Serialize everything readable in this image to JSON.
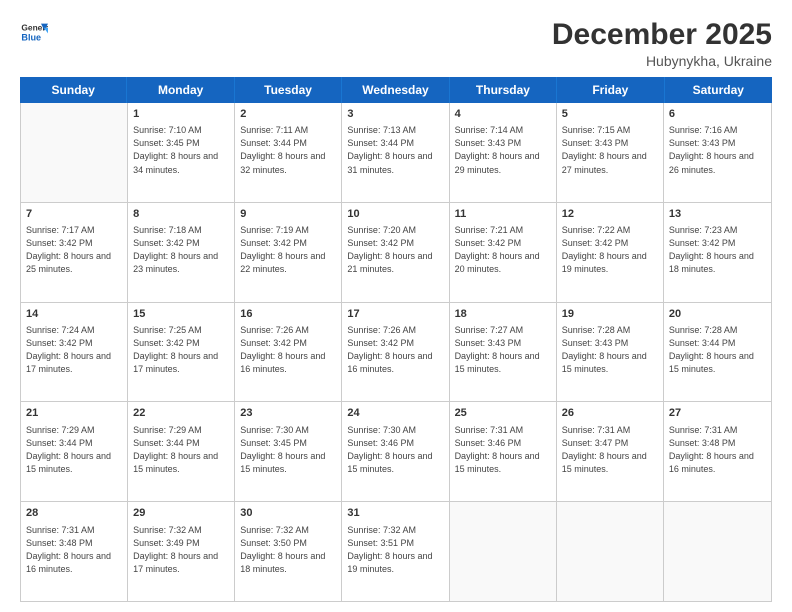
{
  "logo": {
    "general": "General",
    "blue": "Blue"
  },
  "header": {
    "month": "December 2025",
    "location": "Hubynykha, Ukraine"
  },
  "weekdays": [
    "Sunday",
    "Monday",
    "Tuesday",
    "Wednesday",
    "Thursday",
    "Friday",
    "Saturday"
  ],
  "rows": [
    [
      {
        "day": "",
        "empty": true
      },
      {
        "day": "1",
        "sunrise": "Sunrise: 7:10 AM",
        "sunset": "Sunset: 3:45 PM",
        "daylight": "Daylight: 8 hours and 34 minutes."
      },
      {
        "day": "2",
        "sunrise": "Sunrise: 7:11 AM",
        "sunset": "Sunset: 3:44 PM",
        "daylight": "Daylight: 8 hours and 32 minutes."
      },
      {
        "day": "3",
        "sunrise": "Sunrise: 7:13 AM",
        "sunset": "Sunset: 3:44 PM",
        "daylight": "Daylight: 8 hours and 31 minutes."
      },
      {
        "day": "4",
        "sunrise": "Sunrise: 7:14 AM",
        "sunset": "Sunset: 3:43 PM",
        "daylight": "Daylight: 8 hours and 29 minutes."
      },
      {
        "day": "5",
        "sunrise": "Sunrise: 7:15 AM",
        "sunset": "Sunset: 3:43 PM",
        "daylight": "Daylight: 8 hours and 27 minutes."
      },
      {
        "day": "6",
        "sunrise": "Sunrise: 7:16 AM",
        "sunset": "Sunset: 3:43 PM",
        "daylight": "Daylight: 8 hours and 26 minutes."
      }
    ],
    [
      {
        "day": "7",
        "sunrise": "Sunrise: 7:17 AM",
        "sunset": "Sunset: 3:42 PM",
        "daylight": "Daylight: 8 hours and 25 minutes."
      },
      {
        "day": "8",
        "sunrise": "Sunrise: 7:18 AM",
        "sunset": "Sunset: 3:42 PM",
        "daylight": "Daylight: 8 hours and 23 minutes."
      },
      {
        "day": "9",
        "sunrise": "Sunrise: 7:19 AM",
        "sunset": "Sunset: 3:42 PM",
        "daylight": "Daylight: 8 hours and 22 minutes."
      },
      {
        "day": "10",
        "sunrise": "Sunrise: 7:20 AM",
        "sunset": "Sunset: 3:42 PM",
        "daylight": "Daylight: 8 hours and 21 minutes."
      },
      {
        "day": "11",
        "sunrise": "Sunrise: 7:21 AM",
        "sunset": "Sunset: 3:42 PM",
        "daylight": "Daylight: 8 hours and 20 minutes."
      },
      {
        "day": "12",
        "sunrise": "Sunrise: 7:22 AM",
        "sunset": "Sunset: 3:42 PM",
        "daylight": "Daylight: 8 hours and 19 minutes."
      },
      {
        "day": "13",
        "sunrise": "Sunrise: 7:23 AM",
        "sunset": "Sunset: 3:42 PM",
        "daylight": "Daylight: 8 hours and 18 minutes."
      }
    ],
    [
      {
        "day": "14",
        "sunrise": "Sunrise: 7:24 AM",
        "sunset": "Sunset: 3:42 PM",
        "daylight": "Daylight: 8 hours and 17 minutes."
      },
      {
        "day": "15",
        "sunrise": "Sunrise: 7:25 AM",
        "sunset": "Sunset: 3:42 PM",
        "daylight": "Daylight: 8 hours and 17 minutes."
      },
      {
        "day": "16",
        "sunrise": "Sunrise: 7:26 AM",
        "sunset": "Sunset: 3:42 PM",
        "daylight": "Daylight: 8 hours and 16 minutes."
      },
      {
        "day": "17",
        "sunrise": "Sunrise: 7:26 AM",
        "sunset": "Sunset: 3:42 PM",
        "daylight": "Daylight: 8 hours and 16 minutes."
      },
      {
        "day": "18",
        "sunrise": "Sunrise: 7:27 AM",
        "sunset": "Sunset: 3:43 PM",
        "daylight": "Daylight: 8 hours and 15 minutes."
      },
      {
        "day": "19",
        "sunrise": "Sunrise: 7:28 AM",
        "sunset": "Sunset: 3:43 PM",
        "daylight": "Daylight: 8 hours and 15 minutes."
      },
      {
        "day": "20",
        "sunrise": "Sunrise: 7:28 AM",
        "sunset": "Sunset: 3:44 PM",
        "daylight": "Daylight: 8 hours and 15 minutes."
      }
    ],
    [
      {
        "day": "21",
        "sunrise": "Sunrise: 7:29 AM",
        "sunset": "Sunset: 3:44 PM",
        "daylight": "Daylight: 8 hours and 15 minutes."
      },
      {
        "day": "22",
        "sunrise": "Sunrise: 7:29 AM",
        "sunset": "Sunset: 3:44 PM",
        "daylight": "Daylight: 8 hours and 15 minutes."
      },
      {
        "day": "23",
        "sunrise": "Sunrise: 7:30 AM",
        "sunset": "Sunset: 3:45 PM",
        "daylight": "Daylight: 8 hours and 15 minutes."
      },
      {
        "day": "24",
        "sunrise": "Sunrise: 7:30 AM",
        "sunset": "Sunset: 3:46 PM",
        "daylight": "Daylight: 8 hours and 15 minutes."
      },
      {
        "day": "25",
        "sunrise": "Sunrise: 7:31 AM",
        "sunset": "Sunset: 3:46 PM",
        "daylight": "Daylight: 8 hours and 15 minutes."
      },
      {
        "day": "26",
        "sunrise": "Sunrise: 7:31 AM",
        "sunset": "Sunset: 3:47 PM",
        "daylight": "Daylight: 8 hours and 15 minutes."
      },
      {
        "day": "27",
        "sunrise": "Sunrise: 7:31 AM",
        "sunset": "Sunset: 3:48 PM",
        "daylight": "Daylight: 8 hours and 16 minutes."
      }
    ],
    [
      {
        "day": "28",
        "sunrise": "Sunrise: 7:31 AM",
        "sunset": "Sunset: 3:48 PM",
        "daylight": "Daylight: 8 hours and 16 minutes."
      },
      {
        "day": "29",
        "sunrise": "Sunrise: 7:32 AM",
        "sunset": "Sunset: 3:49 PM",
        "daylight": "Daylight: 8 hours and 17 minutes."
      },
      {
        "day": "30",
        "sunrise": "Sunrise: 7:32 AM",
        "sunset": "Sunset: 3:50 PM",
        "daylight": "Daylight: 8 hours and 18 minutes."
      },
      {
        "day": "31",
        "sunrise": "Sunrise: 7:32 AM",
        "sunset": "Sunset: 3:51 PM",
        "daylight": "Daylight: 8 hours and 19 minutes."
      },
      {
        "day": "",
        "empty": true
      },
      {
        "day": "",
        "empty": true
      },
      {
        "day": "",
        "empty": true
      }
    ]
  ]
}
